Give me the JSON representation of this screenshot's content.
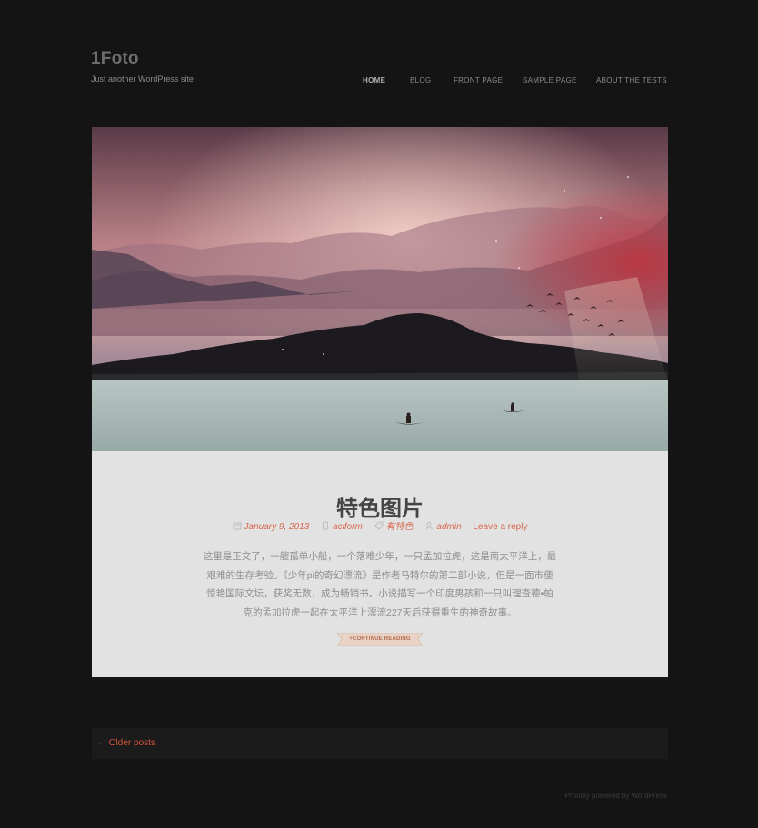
{
  "site": {
    "title": "1Foto",
    "description": "Just another WordPress site"
  },
  "nav": {
    "items": [
      {
        "label": "HOME",
        "active": true
      },
      {
        "label": "BLOG",
        "active": false
      },
      {
        "label": "FRONT PAGE",
        "active": false
      },
      {
        "label": "SAMPLE PAGE",
        "active": false
      },
      {
        "label": "ABOUT THE TESTS",
        "active": false
      }
    ]
  },
  "post": {
    "title": "特色图片",
    "meta": {
      "date": "January 9, 2013",
      "category": "aciform",
      "tag": "有特色",
      "author": "admin",
      "comments": "Leave a reply"
    },
    "excerpt_lines": [
      "这里是正文了，一艘孤单小船，一个落难少年，一只孟加拉虎，这是南太平洋上，最",
      "艰难的生存考验。《少年pi的奇幻漂流》是作者马特尔的第二部小说，但是一面市便",
      "惊艳国际文坛，获奖无数，成为畅销书。小说描写一个印度男孩和一只叫理查德•帕",
      "克的孟加拉虎一起在太平洋上漂流227天后获得重生的神奇故事。"
    ],
    "continue_label": "+CONTINUE READING"
  },
  "pagination": {
    "older_label": "← Older posts"
  },
  "footer": {
    "credit": "Proudly powered by WordPress"
  },
  "colors": {
    "background": "#141414",
    "post_background": "#e2e2e2",
    "accent": "#d7684e"
  }
}
